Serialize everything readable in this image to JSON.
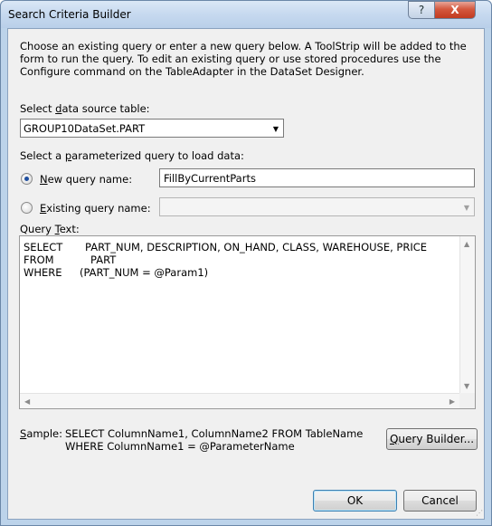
{
  "window": {
    "title": "Search Criteria Builder",
    "help_label": "?",
    "close_label": "X"
  },
  "intro_text": "Choose an existing query or enter a new query below. A ToolStrip will be added to the form to run the query. To edit an existing query or use stored procedures use the Configure command on the TableAdapter in the DataSet Designer.",
  "datasource": {
    "label_pre": "Select ",
    "label_accel": "d",
    "label_post": "ata source table:",
    "value": "GROUP10DataSet.PART"
  },
  "param_query": {
    "label_pre": "Select a ",
    "label_accel": "p",
    "label_post": "arameterized query to load data:"
  },
  "new_query": {
    "label_accel": "N",
    "label_post": "ew query name:",
    "value": "FillByCurrentParts",
    "selected": true
  },
  "existing_query": {
    "label_accel": "E",
    "label_post": "xisting query name:",
    "value": "",
    "selected": false
  },
  "query_text": {
    "label_pre": "Query ",
    "label_accel": "T",
    "label_post": "ext:",
    "lines": [
      {
        "keyword": "SELECT",
        "value": "PART_NUM, DESCRIPTION, ON_HAND, CLASS, WAREHOUSE, PRICE"
      },
      {
        "keyword": "FROM",
        "value": "PART"
      },
      {
        "keyword": "WHERE",
        "value": "(PART_NUM = @Param1)"
      }
    ]
  },
  "sample": {
    "label_accel": "S",
    "label_post": "ample:",
    "line1": "SELECT ColumnName1, ColumnName2 FROM TableName",
    "line2": "WHERE ColumnName1 = @ParameterName"
  },
  "buttons": {
    "query_builder_accel": "Q",
    "query_builder_post": "uery Builder...",
    "ok": "OK",
    "cancel": "Cancel"
  },
  "icons": {
    "dropdown": "chevron-down-icon",
    "scroll_up": "arrow-up-icon",
    "scroll_down": "arrow-down-icon",
    "scroll_left": "arrow-left-icon",
    "scroll_right": "arrow-right-icon"
  }
}
